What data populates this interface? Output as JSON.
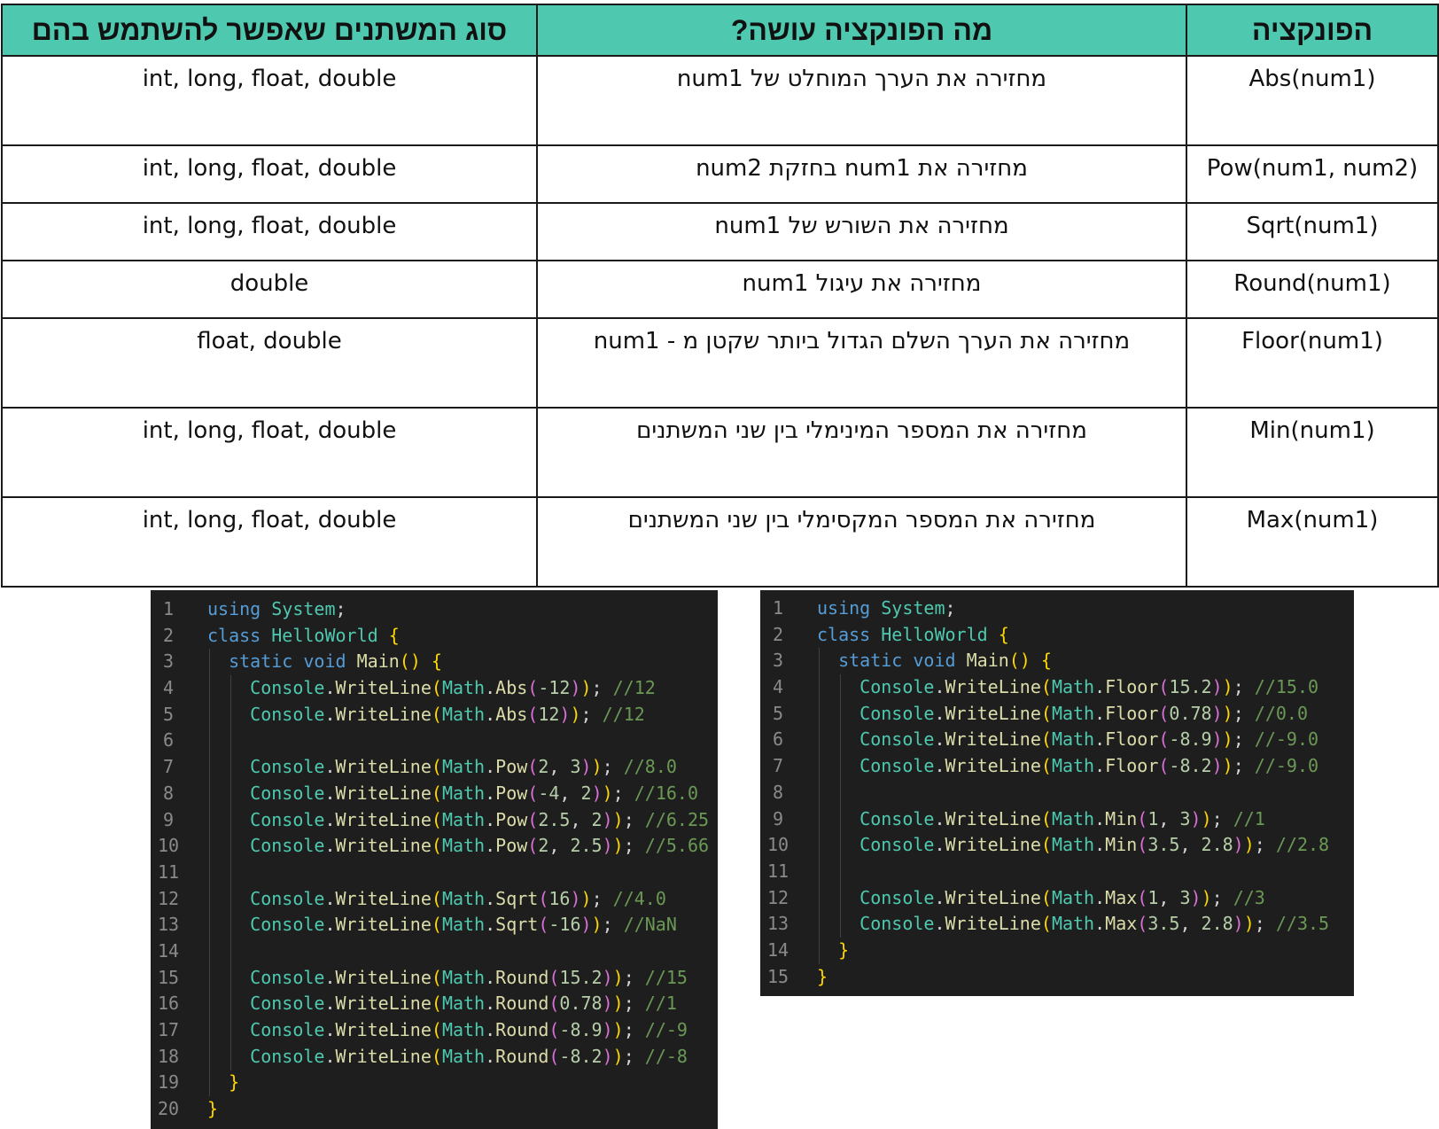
{
  "table": {
    "headers": {
      "function": "הפונקציה",
      "description": "מה הפונקציה עושה?",
      "types": "סוג המשתנים שאפשר להשתמש בהם"
    },
    "rows": [
      {
        "function": "Abs(num1)",
        "description": "מחזירה את הערך המוחלט של num1",
        "types": "int, long, float, double"
      },
      {
        "function": "Pow(num1, num2)",
        "description": "מחזירה את num1 בחזקת num2",
        "types": "int, long, float, double"
      },
      {
        "function": "Sqrt(num1)",
        "description": "מחזירה את השורש של num1",
        "types": "int, long, float, double"
      },
      {
        "function": "Round(num1)",
        "description": "מחזירה את עיגול num1",
        "types": "double"
      },
      {
        "function": "Floor(num1)",
        "description": "מחזירה את הערך השלם הגדול ביותר שקטן מ - num1",
        "types": "float, double"
      },
      {
        "function": "Min(num1)",
        "description": "מחזירה את המספר המינימלי בין שני המשתנים",
        "types": "int, long, float, double"
      },
      {
        "function": "Max(num1)",
        "description": "מחזירה את המספר המקסימלי בין שני המשתנים",
        "types": "int, long, float, double"
      }
    ]
  },
  "code_left": {
    "lines": [
      {
        "n": "1",
        "text": "using System;"
      },
      {
        "n": "2",
        "text": "class HelloWorld {"
      },
      {
        "n": "3",
        "text": "  static void Main() {"
      },
      {
        "n": "4",
        "text": "    Console.WriteLine(Math.Abs(-12)); //12"
      },
      {
        "n": "5",
        "text": "    Console.WriteLine(Math.Abs(12)); //12"
      },
      {
        "n": "6",
        "text": ""
      },
      {
        "n": "7",
        "text": "    Console.WriteLine(Math.Pow(2, 3)); //8.0"
      },
      {
        "n": "8",
        "text": "    Console.WriteLine(Math.Pow(-4, 2)); //16.0"
      },
      {
        "n": "9",
        "text": "    Console.WriteLine(Math.Pow(2.5, 2)); //6.25"
      },
      {
        "n": "10",
        "text": "    Console.WriteLine(Math.Pow(2, 2.5)); //5.66"
      },
      {
        "n": "11",
        "text": ""
      },
      {
        "n": "12",
        "text": "    Console.WriteLine(Math.Sqrt(16)); //4.0"
      },
      {
        "n": "13",
        "text": "    Console.WriteLine(Math.Sqrt(-16)); //NaN"
      },
      {
        "n": "14",
        "text": ""
      },
      {
        "n": "15",
        "text": "    Console.WriteLine(Math.Round(15.2)); //15"
      },
      {
        "n": "16",
        "text": "    Console.WriteLine(Math.Round(0.78)); //1"
      },
      {
        "n": "17",
        "text": "    Console.WriteLine(Math.Round(-8.9)); //-9"
      },
      {
        "n": "18",
        "text": "    Console.WriteLine(Math.Round(-8.2)); //-8"
      },
      {
        "n": "19",
        "text": "  }"
      },
      {
        "n": "20",
        "text": "}"
      }
    ]
  },
  "code_right": {
    "lines": [
      {
        "n": "1",
        "text": "using System;"
      },
      {
        "n": "2",
        "text": "class HelloWorld {"
      },
      {
        "n": "3",
        "text": "  static void Main() {"
      },
      {
        "n": "4",
        "text": "    Console.WriteLine(Math.Floor(15.2)); //15.0"
      },
      {
        "n": "5",
        "text": "    Console.WriteLine(Math.Floor(0.78)); //0.0"
      },
      {
        "n": "6",
        "text": "    Console.WriteLine(Math.Floor(-8.9)); //-9.0"
      },
      {
        "n": "7",
        "text": "    Console.WriteLine(Math.Floor(-8.2)); //-9.0"
      },
      {
        "n": "8",
        "text": ""
      },
      {
        "n": "9",
        "text": "    Console.WriteLine(Math.Min(1, 3)); //1"
      },
      {
        "n": "10",
        "text": "    Console.WriteLine(Math.Min(3.5, 2.8)); //2.8"
      },
      {
        "n": "11",
        "text": ""
      },
      {
        "n": "12",
        "text": "    Console.WriteLine(Math.Max(1, 3)); //3"
      },
      {
        "n": "13",
        "text": "    Console.WriteLine(Math.Max(3.5, 2.8)); //3.5"
      },
      {
        "n": "14",
        "text": "  }"
      },
      {
        "n": "15",
        "text": "}"
      }
    ]
  }
}
